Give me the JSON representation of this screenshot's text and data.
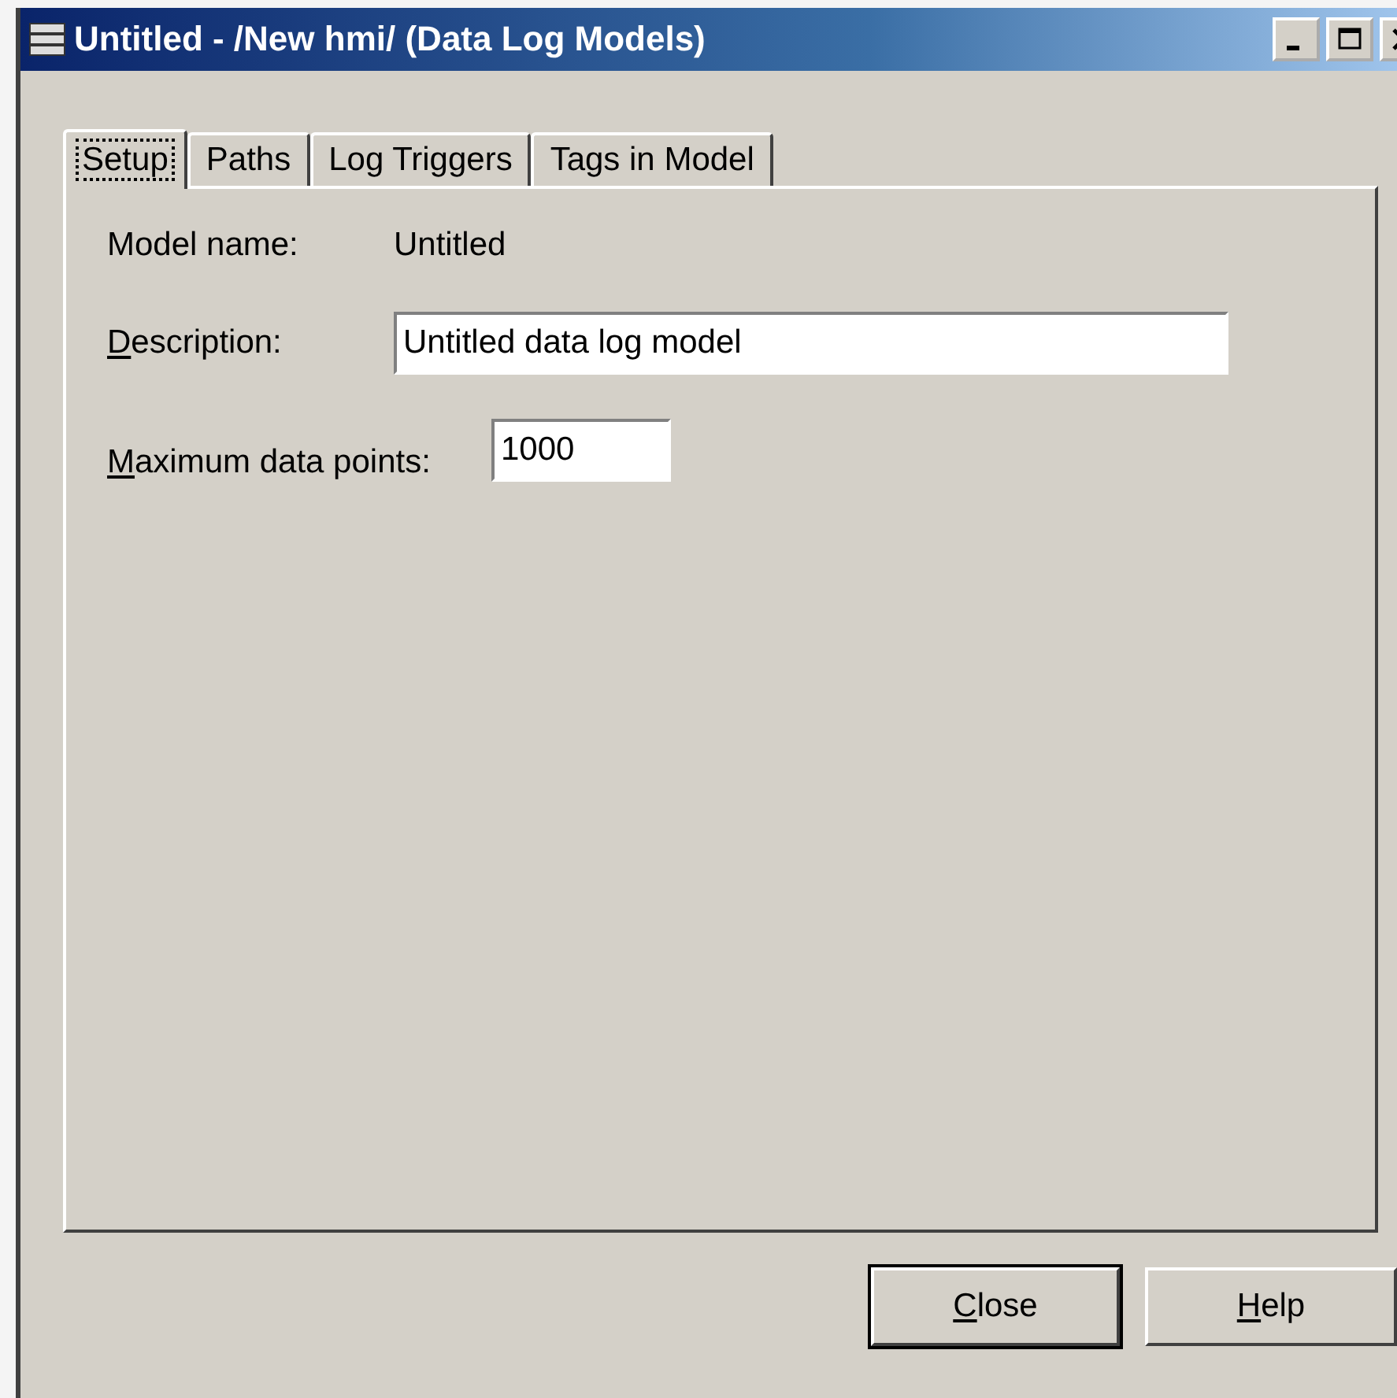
{
  "window": {
    "title": "Untitled - /New hmi/ (Data Log Models)"
  },
  "tabs": [
    {
      "label": "Setup",
      "selected": true
    },
    {
      "label": "Paths",
      "selected": false
    },
    {
      "label": "Log Triggers",
      "selected": false
    },
    {
      "label": "Tags in Model",
      "selected": false
    }
  ],
  "fields": [
    {
      "kind": "static",
      "label": "Model name:",
      "mnemonic": false,
      "value": "Untitled"
    },
    {
      "kind": "input",
      "label": "Description:",
      "mnemonic": true,
      "value": "Untitled data log model"
    },
    {
      "kind": "short_input",
      "label": "Maximum data points:",
      "mnemonic": true,
      "value": "1000"
    }
  ],
  "buttons": [
    {
      "label": "Close",
      "mnemonic": true,
      "default": true
    },
    {
      "label": "Help",
      "mnemonic": true,
      "default": false
    }
  ]
}
